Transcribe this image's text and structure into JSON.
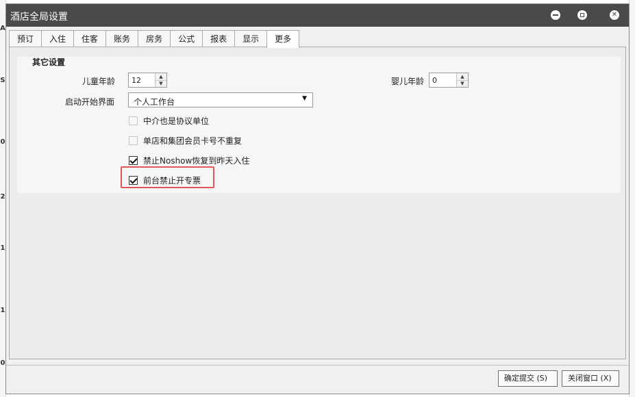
{
  "window": {
    "title": "酒店全局设置"
  },
  "background_letters": [
    "A",
    "S",
    "0",
    "2",
    "1",
    "1",
    "0"
  ],
  "tabs": [
    {
      "label": "预订"
    },
    {
      "label": "入住"
    },
    {
      "label": "住客"
    },
    {
      "label": "账务"
    },
    {
      "label": "房务"
    },
    {
      "label": "公式"
    },
    {
      "label": "报表"
    },
    {
      "label": "显示"
    },
    {
      "label": "更多",
      "active": true
    }
  ],
  "group": {
    "title": "其它设置",
    "child_age": {
      "label": "儿童年龄",
      "value": "12"
    },
    "infant_age": {
      "label": "婴儿年龄",
      "value": "0"
    },
    "startup": {
      "label": "启动开始界面",
      "value": "个人工作台"
    },
    "checkboxes": [
      {
        "label": "中介也是协议单位",
        "checked": false
      },
      {
        "label": "单店和集团会员卡号不重复",
        "checked": false
      },
      {
        "label": "禁止Noshow恢复到昨天入住",
        "checked": true
      },
      {
        "label": "前台禁止开专票",
        "checked": true
      }
    ]
  },
  "buttons": {
    "ok": "确定提交 (S)",
    "close": "关闭窗口 (X)"
  },
  "colors": {
    "titlebar": "#4a4a4a",
    "highlight": "#e05555"
  }
}
